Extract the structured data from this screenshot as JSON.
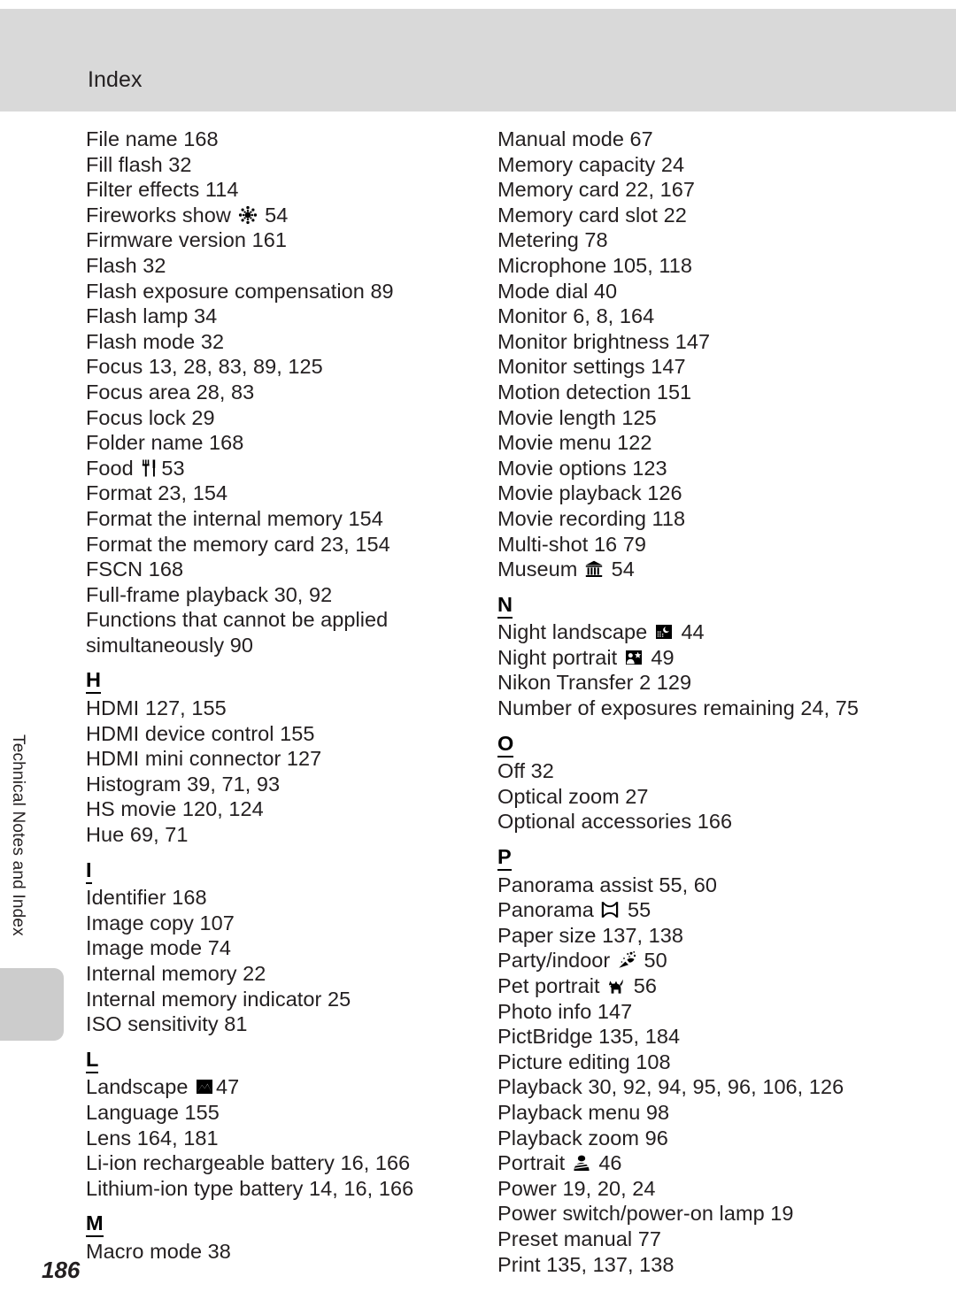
{
  "header": {
    "title": "Index"
  },
  "side_tab": {
    "label": "Technical Notes and Index"
  },
  "page_number": "186",
  "colors": {
    "header_bg": "#d9d9d9",
    "tab_bg": "#cccccc",
    "text": "#231f20",
    "page_bg": "#ffffff"
  },
  "columns": [
    {
      "name": "left-column",
      "blocks": [
        {
          "type": "entries",
          "items": [
            {
              "text": "File name 168"
            },
            {
              "text": "Fill flash 32"
            },
            {
              "text": "Filter effects 114"
            },
            {
              "text": "Fireworks show ",
              "icon": "fireworks-icon",
              "after": " 54"
            },
            {
              "text": "Firmware version 161"
            },
            {
              "text": "Flash 32"
            },
            {
              "text": "Flash exposure compensation 89"
            },
            {
              "text": "Flash lamp 34"
            },
            {
              "text": "Flash mode 32"
            },
            {
              "text": "Focus 13, 28, 83, 89, 125"
            },
            {
              "text": "Focus area 28, 83"
            },
            {
              "text": "Focus lock 29"
            },
            {
              "text": "Folder name 168"
            },
            {
              "text": "Food ",
              "icon": "food-icon",
              "after": "53"
            },
            {
              "text": "Format 23, 154"
            },
            {
              "text": "Format the internal memory 154"
            },
            {
              "text": "Format the memory card 23, 154"
            },
            {
              "text": "FSCN 168"
            },
            {
              "text": "Full-frame playback 30, 92"
            },
            {
              "text": "Functions that cannot be applied simultaneously 90",
              "wrap": true
            }
          ]
        },
        {
          "type": "letter",
          "letter": "H"
        },
        {
          "type": "entries",
          "items": [
            {
              "text": "HDMI 127, 155"
            },
            {
              "text": "HDMI device control 155"
            },
            {
              "text": "HDMI mini connector 127"
            },
            {
              "text": "Histogram 39, 71, 93"
            },
            {
              "text": "HS movie 120, 124"
            },
            {
              "text": "Hue 69, 71"
            }
          ]
        },
        {
          "type": "letter",
          "letter": "I"
        },
        {
          "type": "entries",
          "items": [
            {
              "text": "Identifier 168"
            },
            {
              "text": "Image copy 107"
            },
            {
              "text": "Image mode 74"
            },
            {
              "text": "Internal memory 22"
            },
            {
              "text": "Internal memory indicator 25"
            },
            {
              "text": "ISO sensitivity 81"
            }
          ]
        },
        {
          "type": "letter",
          "letter": "L"
        },
        {
          "type": "entries",
          "items": [
            {
              "text": "Landscape ",
              "icon": "landscape-icon",
              "after": "47"
            },
            {
              "text": "Language 155"
            },
            {
              "text": "Lens 164, 181"
            },
            {
              "text": "Li-ion rechargeable battery 16, 166"
            },
            {
              "text": "Lithium-ion type battery 14, 16, 166"
            }
          ]
        },
        {
          "type": "letter",
          "letter": "M"
        },
        {
          "type": "entries",
          "items": [
            {
              "text": "Macro mode 38"
            }
          ]
        }
      ]
    },
    {
      "name": "right-column",
      "blocks": [
        {
          "type": "entries",
          "items": [
            {
              "text": "Manual mode 67"
            },
            {
              "text": "Memory capacity 24"
            },
            {
              "text": "Memory card 22, 167"
            },
            {
              "text": "Memory card slot 22"
            },
            {
              "text": "Metering 78"
            },
            {
              "text": "Microphone 105, 118"
            },
            {
              "text": "Mode dial 40"
            },
            {
              "text": "Monitor 6, 8, 164"
            },
            {
              "text": "Monitor brightness 147"
            },
            {
              "text": "Monitor settings 147"
            },
            {
              "text": "Motion detection 151"
            },
            {
              "text": "Movie length 125"
            },
            {
              "text": "Movie menu 122"
            },
            {
              "text": "Movie options 123"
            },
            {
              "text": "Movie playback 126"
            },
            {
              "text": "Movie recording 118"
            },
            {
              "text": "Multi-shot 16 79"
            },
            {
              "text": "Museum ",
              "icon": "museum-icon",
              "after": " 54"
            }
          ]
        },
        {
          "type": "letter",
          "letter": "N"
        },
        {
          "type": "entries",
          "items": [
            {
              "text": "Night landscape ",
              "icon": "night-landscape-icon",
              "after": " 44"
            },
            {
              "text": "Night portrait ",
              "icon": "night-portrait-icon",
              "after": " 49"
            },
            {
              "text": "Nikon Transfer 2 129"
            },
            {
              "text": "Number of exposures remaining 24, 75"
            }
          ]
        },
        {
          "type": "letter",
          "letter": "O"
        },
        {
          "type": "entries",
          "items": [
            {
              "text": "Off 32"
            },
            {
              "text": "Optical zoom 27"
            },
            {
              "text": "Optional accessories 166"
            }
          ]
        },
        {
          "type": "letter",
          "letter": "P"
        },
        {
          "type": "entries",
          "items": [
            {
              "text": "Panorama assist 55, 60"
            },
            {
              "text": "Panorama ",
              "icon": "panorama-icon",
              "after": " 55"
            },
            {
              "text": "Paper size 137, 138"
            },
            {
              "text": "Party/indoor ",
              "icon": "party-icon",
              "after": " 50"
            },
            {
              "text": "Pet portrait ",
              "icon": "pet-portrait-icon",
              "after": " 56"
            },
            {
              "text": "Photo info 147"
            },
            {
              "text": "PictBridge 135, 184"
            },
            {
              "text": "Picture editing 108"
            },
            {
              "text": "Playback 30, 92, 94, 95, 96, 106, 126"
            },
            {
              "text": "Playback menu 98"
            },
            {
              "text": "Playback zoom 96"
            },
            {
              "text": "Portrait ",
              "icon": "portrait-icon",
              "after": " 46"
            },
            {
              "text": "Power 19, 20, 24"
            },
            {
              "text": "Power switch/power-on lamp 19"
            },
            {
              "text": "Preset manual 77"
            },
            {
              "text": "Print 135, 137, 138"
            }
          ]
        }
      ]
    }
  ]
}
